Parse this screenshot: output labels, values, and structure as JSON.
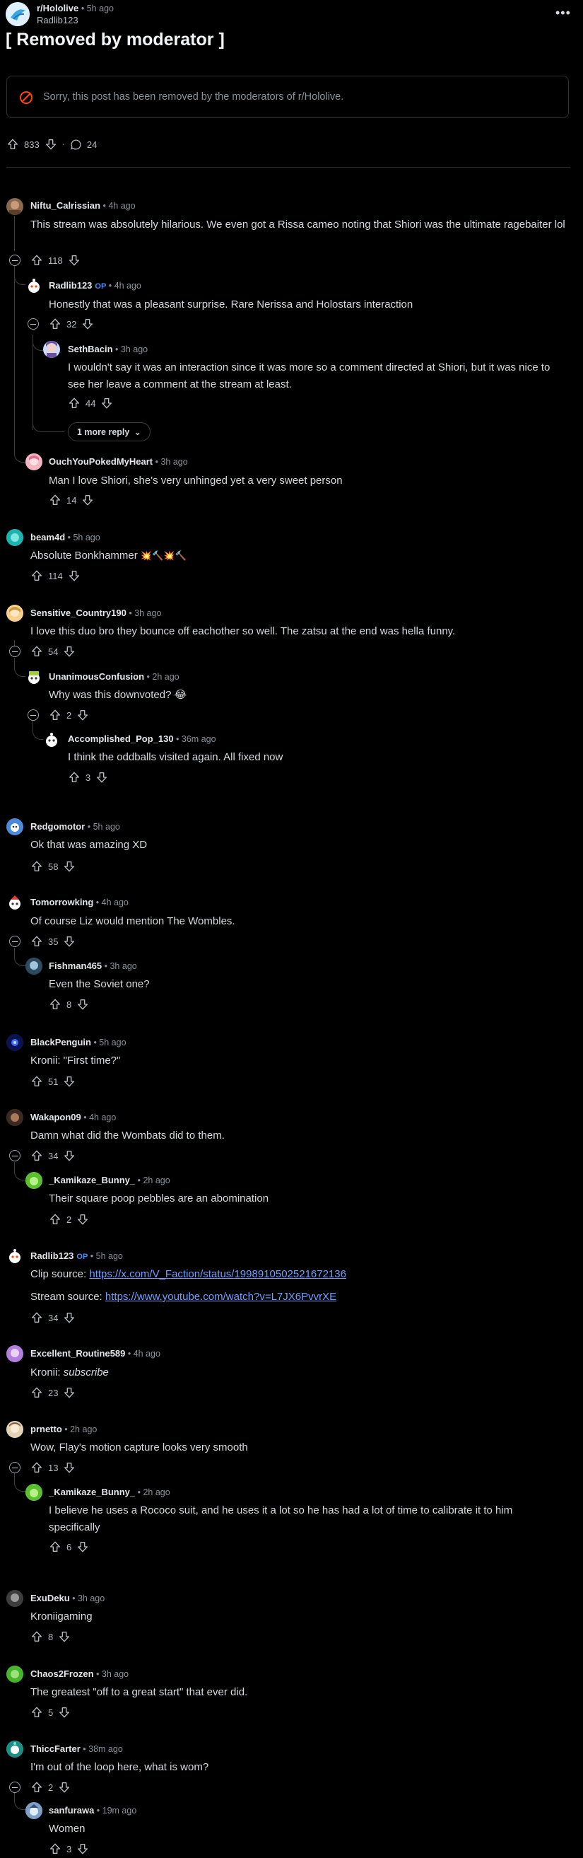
{
  "post": {
    "subreddit": "r/Hololive",
    "time": "5h ago",
    "author": "Radlib123",
    "title": "[ Removed by moderator ]",
    "removed_notice": "Sorry, this post has been removed by the moderators of r/Hololive.",
    "upvotes": "833",
    "comments": "24"
  },
  "colors": {
    "bg": "#000000",
    "accent_op": "#4a8cff",
    "link": "#6ea0ff",
    "removed_icon": "#ff4500"
  },
  "comments": [
    {
      "user": "Niftu_Calrissian",
      "time": "4h ago",
      "text": "This stream was absolutely hilarious. We even got a Rissa cameo noting that Shiori was the ultimate ragebaiter lol",
      "votes": "118"
    },
    {
      "user": "Radlib123",
      "op": "OP",
      "time": "4h ago",
      "text": "Honestly that was a pleasant surprise. Rare Nerissa and Holostars interaction",
      "votes": "32"
    },
    {
      "user": "SethBacin",
      "time": "3h ago",
      "text": "I wouldn't say it was an interaction since it was more so a comment directed at Shiori, but it was nice to see her leave a comment at the stream at least.",
      "votes": "44"
    },
    {
      "more": "1 more reply"
    },
    {
      "user": "OuchYouPokedMyHeart",
      "time": "3h ago",
      "text": "Man I love Shiori, she's very unhinged yet a very sweet person",
      "votes": "14"
    },
    {
      "user": "beam4d",
      "time": "5h ago",
      "text": "Absolute Bonkhammer",
      "emoji": "💥🔨💥🔨",
      "votes": "114"
    },
    {
      "user": "Sensitive_Country190",
      "time": "3h ago",
      "text": "I love this duo bro they bounce off eachother so well. The zatsu at the end was hella funny.",
      "votes": "54"
    },
    {
      "user": "UnanimousConfusion",
      "time": "2h ago",
      "text": "Why was this downvoted?",
      "emoji": "😂",
      "votes": "2"
    },
    {
      "user": "Accomplished_Pop_130",
      "time": "36m ago",
      "text": "I think the oddballs visited again. All fixed now",
      "votes": "3"
    },
    {
      "user": "Redgomotor",
      "time": "5h ago",
      "text": "Ok that was amazing XD",
      "votes": "58"
    },
    {
      "user": "Tomorrowking",
      "time": "4h ago",
      "text": "Of course Liz would mention The Wombles.",
      "votes": "35"
    },
    {
      "user": "Fishman465",
      "time": "3h ago",
      "text": "Even the Soviet one?",
      "votes": "8"
    },
    {
      "user": "BlackPenguin",
      "time": "5h ago",
      "text": "Kronii: \"First time?\"",
      "votes": "51"
    },
    {
      "user": "Wakapon09",
      "time": "4h ago",
      "text": "Damn what did the Wombats did to them.",
      "votes": "34"
    },
    {
      "user": "_Kamikaze_Bunny_",
      "time": "2h ago",
      "text": "Their square poop pebbles are an abomination",
      "votes": "2"
    },
    {
      "user": "Radlib123",
      "op": "OP",
      "time": "5h ago",
      "clip_label": "Clip source:",
      "clip_url": "https://x.com/V_Faction/status/1998910502521672136",
      "stream_label": "Stream source:",
      "stream_url": "https://www.youtube.com/watch?v=L7JX6PvvrXE",
      "votes": "34"
    },
    {
      "user": "Excellent_Routine589",
      "time": "4h ago",
      "text_prefix": "Kronii:",
      "text_italic": "subscribe",
      "votes": "23"
    },
    {
      "user": "prnetto",
      "time": "2h ago",
      "text": "Wow, Flay's motion capture looks very smooth",
      "votes": "13"
    },
    {
      "user": "_Kamikaze_Bunny_",
      "time": "2h ago",
      "text": "I believe he uses a Rococo suit, and he uses it a lot so he has had a lot of time to calibrate it to him specifically",
      "votes": "6"
    },
    {
      "user": "ExuDeku",
      "time": "3h ago",
      "text": "Kroniigaming",
      "votes": "8"
    },
    {
      "user": "Chaos2Frozen",
      "time": "3h ago",
      "text": "The greatest \"off to a great start\" that ever did.",
      "votes": "5"
    },
    {
      "user": "ThiccFarter",
      "time": "38m ago",
      "text": "I'm out of the loop here, what is wom?",
      "votes": "2"
    },
    {
      "user": "sanfurawa",
      "time": "19m ago",
      "text": "Women",
      "votes": "3"
    }
  ]
}
